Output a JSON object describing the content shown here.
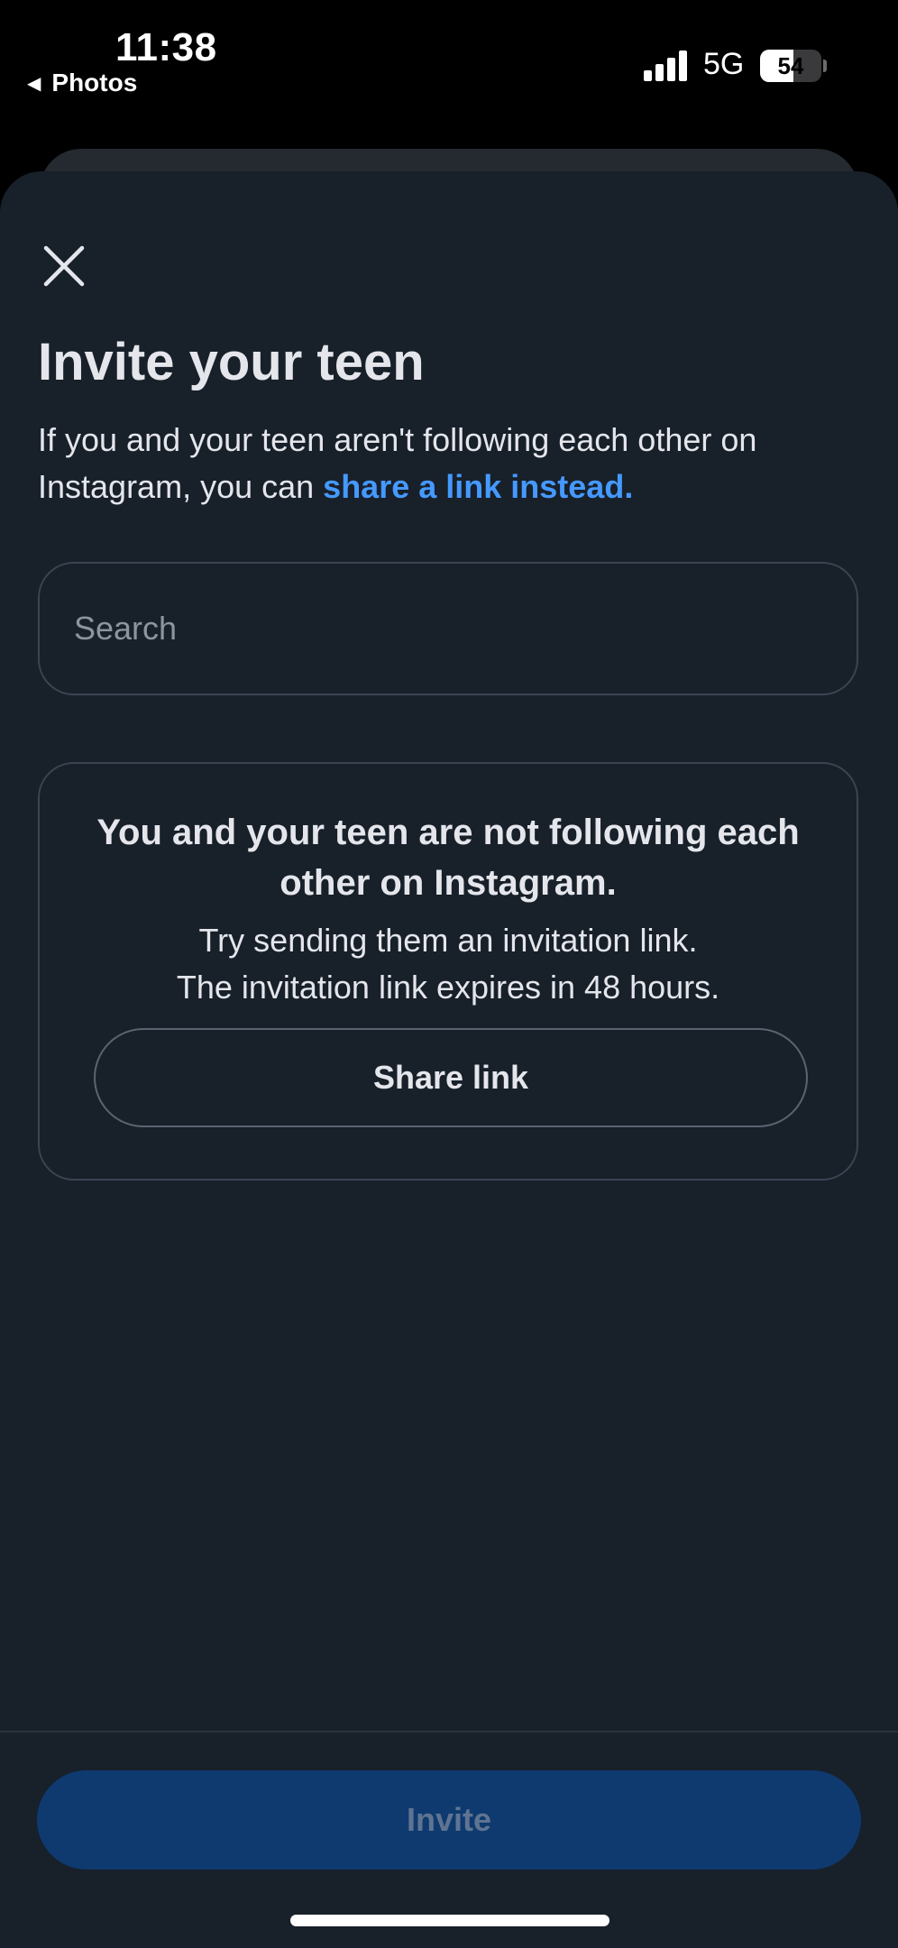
{
  "status_bar": {
    "time": "11:38",
    "back_label": "Photos",
    "network": "5G",
    "battery": 54
  },
  "sheet": {
    "title": "Invite your teen",
    "subtitle_text": "If you and your teen aren't following each other on Instagram, you can ",
    "subtitle_link": "share a link instead.",
    "search": {
      "placeholder": "Search",
      "value": ""
    },
    "notice": {
      "heading": "You and your teen are not following each other on Instagram.",
      "line1": "Try sending them an invitation link.",
      "line2": "The invitation link expires in 48 hours.",
      "share_button": "Share link"
    },
    "invite_button": "Invite"
  },
  "icons": {
    "close": "close-icon",
    "signal": "cellular-signal-icon",
    "back": "back-arrow-icon"
  },
  "colors": {
    "background": "#18202A",
    "link": "#4599FF",
    "invite_button": "#0E3A70",
    "invite_text_disabled": "#5F7491"
  }
}
